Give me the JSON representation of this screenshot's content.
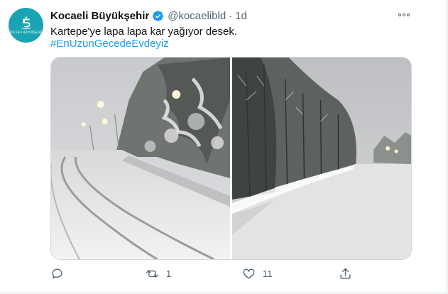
{
  "tweet": {
    "author_name": "Kocaeli Büyükşehir",
    "handle": "@kocaelibld",
    "separator": "·",
    "time": "1d",
    "text": "Kartepe'ye lapa lapa kar yağıyor desek.",
    "hashtag": "#EnUzunGecedeEvdeyiz"
  },
  "avatar": {
    "text": "KOCAELİ BÜYÜKŞEHİR",
    "color": "#1aa3b3"
  },
  "media": [
    {
      "icon": "snowy-road-photo",
      "description_icon": "image"
    },
    {
      "icon": "snowy-forest-road-photo",
      "description_icon": "image"
    }
  ],
  "actions": {
    "reply": {
      "icon": "reply-icon",
      "count": ""
    },
    "retweet": {
      "icon": "retweet-icon",
      "count": "1"
    },
    "like": {
      "icon": "heart-icon",
      "count": "11"
    },
    "share": {
      "icon": "share-icon",
      "count": ""
    }
  },
  "colors": {
    "text": "#0f1419",
    "secondary": "#536471",
    "link": "#1d9bf0",
    "verified": "#1d9bf0",
    "border": "#cfd9de"
  }
}
